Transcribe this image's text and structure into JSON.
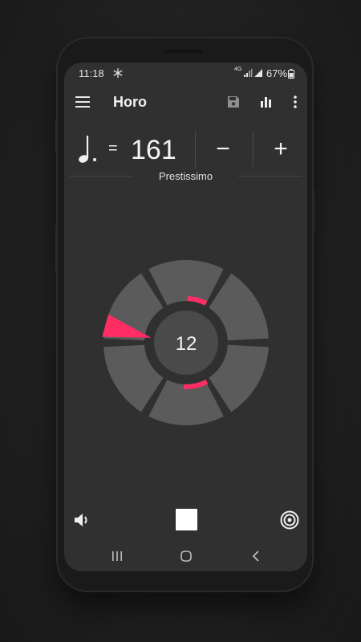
{
  "status_bar": {
    "time": "11:18",
    "network": "4G",
    "battery": "67%",
    "icons": [
      "snowflake-icon",
      "wifi-icon",
      "signal-icon",
      "battery-icon"
    ]
  },
  "toolbar": {
    "title": "Horo",
    "icons": [
      "menu-icon",
      "save-icon",
      "bar-chart-icon",
      "more-vert-icon"
    ]
  },
  "tempo": {
    "note_icon": "dotted-quarter-note-icon",
    "equals": "=",
    "bpm": "161",
    "decrease_label": "−",
    "increase_label": "+",
    "name": "Prestissimo"
  },
  "wheel": {
    "center_label": "12",
    "segments": 6,
    "active_color": "#ff2d63",
    "inactive_color": "#5b5b5b",
    "inner_color": "#4a4a4a"
  },
  "controls": {
    "icons": [
      "volume-icon",
      "stop-icon",
      "target-icon"
    ]
  },
  "nav": {
    "icons": [
      "recents-icon",
      "home-icon",
      "back-icon"
    ]
  },
  "colors": {
    "screen_bg": "#303030",
    "accent": "#ff2d63",
    "text": "#f2f2f2"
  }
}
